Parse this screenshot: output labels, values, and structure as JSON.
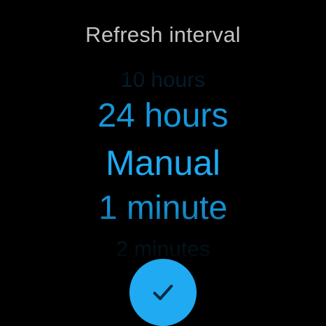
{
  "header": {
    "title": "Refresh interval"
  },
  "picker": {
    "items": [
      {
        "label": "10 hours"
      },
      {
        "label": "24 hours"
      },
      {
        "label": "Manual"
      },
      {
        "label": "1 minute"
      },
      {
        "label": "2 minutes"
      }
    ],
    "selected_label": "Manual"
  },
  "confirm": {
    "icon": "check-icon"
  },
  "colors": {
    "background": "#000000",
    "accent": "#1faaf2",
    "title": "#c2c2c2",
    "check": "#0a2a3f"
  }
}
